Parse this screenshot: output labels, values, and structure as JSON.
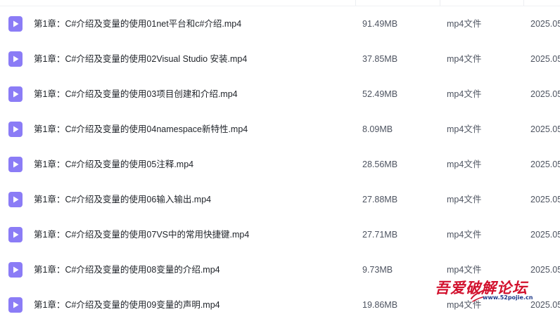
{
  "file_list": {
    "rows": [
      {
        "name": "第1章：C#介绍及变量的使用01net平台和c#介绍.mp4",
        "size": "91.49MB",
        "type": "mp4文件",
        "date": "2025.05"
      },
      {
        "name": "第1章：C#介绍及变量的使用02Visual Studio 安装.mp4",
        "size": "37.85MB",
        "type": "mp4文件",
        "date": "2025.05"
      },
      {
        "name": "第1章：C#介绍及变量的使用03项目创建和介绍.mp4",
        "size": "52.49MB",
        "type": "mp4文件",
        "date": "2025.05"
      },
      {
        "name": "第1章：C#介绍及变量的使用04namespace新特性.mp4",
        "size": "8.09MB",
        "type": "mp4文件",
        "date": "2025.05"
      },
      {
        "name": "第1章：C#介绍及变量的使用05注释.mp4",
        "size": "28.56MB",
        "type": "mp4文件",
        "date": "2025.05"
      },
      {
        "name": "第1章：C#介绍及变量的使用06输入输出.mp4",
        "size": "27.88MB",
        "type": "mp4文件",
        "date": "2025.05"
      },
      {
        "name": "第1章：C#介绍及变量的使用07VS中的常用快捷键.mp4",
        "size": "27.71MB",
        "type": "mp4文件",
        "date": "2025.05"
      },
      {
        "name": "第1章：C#介绍及变量的使用08变量的介绍.mp4",
        "size": "9.73MB",
        "type": "mp4文件",
        "date": "2025.05"
      },
      {
        "name": "第1章：C#介绍及变量的使用09变量的声明.mp4",
        "size": "19.86MB",
        "type": "mp4文件",
        "date": "2025.05"
      }
    ],
    "icon": "video-file-icon",
    "icon_color": "#8b7cf6"
  },
  "watermark": {
    "title": "吾爱破解论坛",
    "url": "www.52pojie.cn",
    "color": "#d2122e"
  }
}
